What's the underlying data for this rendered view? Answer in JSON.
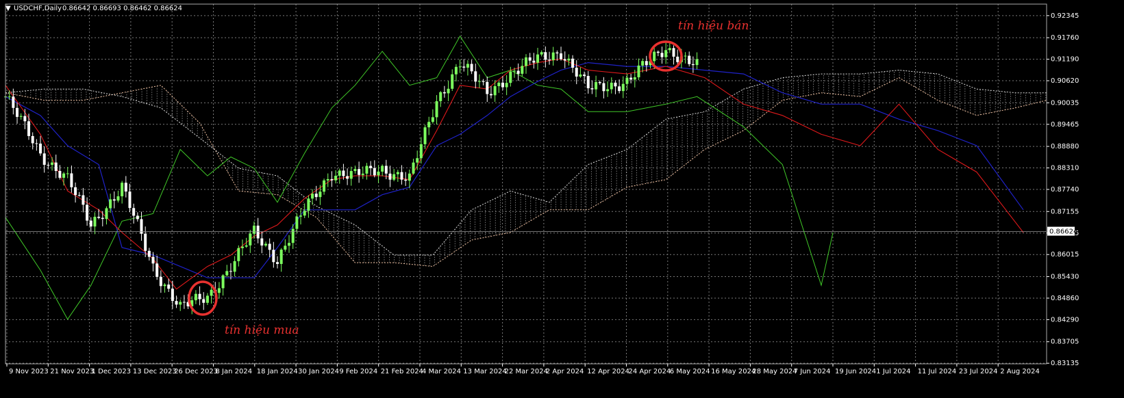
{
  "header": {
    "symbol": "USDCHF,Daily",
    "ohlc": "0.86642 0.86693 0.86462 0.86624"
  },
  "colors": {
    "background": "#000000",
    "grid": "#7a7a7a",
    "bull_candle": "#7cff5e",
    "bear_candle": "#ffffff",
    "tenkan_sen": "#e0191b",
    "kijun_sen": "#1f22c8",
    "chikou_span": "#40c828",
    "cloud": "#e8e8e8",
    "annotation": "#e8312f",
    "text": "#ffffff"
  },
  "annotations": {
    "buy_signal": "tín hiệu mua",
    "sell_signal": "tín hiệu bán"
  },
  "chart_data": {
    "type": "line",
    "ylim": [
      0.8312,
      0.9265
    ],
    "y_ticks": [
      "0.92345",
      "0.91760",
      "0.91190",
      "0.90620",
      "0.90035",
      "0.89465",
      "0.88880",
      "0.88310",
      "0.87740",
      "0.87155",
      "0.86585",
      "0.86015",
      "0.85430",
      "0.84860",
      "0.84290",
      "0.83705",
      "0.83135"
    ],
    "x_ticks": [
      "9 Nov 2023",
      "21 Nov 2023",
      "1 Dec 2023",
      "13 Dec 2023",
      "26 Dec 2023",
      "8 Jan 2024",
      "18 Jan 2024",
      "30 Jan 2024",
      "9 Feb 2024",
      "21 Feb 2024",
      "4 Mar 2024",
      "13 Mar 2024",
      "22 Mar 2024",
      "2 Apr 2024",
      "12 Apr 2024",
      "24 Apr 2024",
      "6 May 2024",
      "16 May 2024",
      "28 May 2024",
      "7 Jun 2024",
      "19 Jun 2024",
      "1 Jul 2024",
      "11 Jul 2024",
      "23 Jul 2024",
      "2 Aug 2024"
    ],
    "last_price": "0.86624",
    "series": [
      {
        "key": "price",
        "x": [
          0,
          9,
          16,
          22,
          30,
          38,
          45,
          52,
          58,
          64,
          70,
          77,
          84,
          90,
          97,
          104,
          111,
          117,
          124,
          130,
          137,
          143,
          150,
          160,
          170,
          178
        ],
        "y": [
          0.902,
          0.887,
          0.88,
          0.868,
          0.878,
          0.857,
          0.846,
          0.849,
          0.857,
          0.866,
          0.859,
          0.872,
          0.882,
          0.881,
          0.883,
          0.88,
          0.901,
          0.911,
          0.903,
          0.908,
          0.912,
          0.914,
          0.904,
          0.906,
          0.915,
          0.91
        ]
      },
      {
        "key": "tenkan",
        "x": [
          0,
          9,
          16,
          24,
          30,
          38,
          44,
          52,
          58,
          64,
          70,
          77,
          84,
          90,
          97,
          104,
          111,
          117,
          124,
          130,
          137,
          143,
          150,
          160,
          170,
          180,
          190,
          200,
          210,
          220,
          230,
          240,
          250,
          262
        ],
        "y": [
          0.905,
          0.892,
          0.877,
          0.872,
          0.866,
          0.859,
          0.851,
          0.857,
          0.86,
          0.865,
          0.868,
          0.875,
          0.88,
          0.881,
          0.881,
          0.88,
          0.893,
          0.905,
          0.904,
          0.909,
          0.911,
          0.912,
          0.909,
          0.908,
          0.91,
          0.907,
          0.9,
          0.897,
          0.892,
          0.889,
          0.9,
          0.888,
          0.882,
          0.866
        ]
      },
      {
        "key": "kijun",
        "x": [
          0,
          9,
          16,
          24,
          30,
          38,
          45,
          52,
          58,
          64,
          70,
          77,
          84,
          90,
          97,
          104,
          111,
          117,
          124,
          130,
          137,
          143,
          150,
          160,
          170,
          180,
          190,
          200,
          210,
          220,
          230,
          240,
          250,
          262
        ],
        "y": [
          0.902,
          0.897,
          0.889,
          0.884,
          0.862,
          0.86,
          0.857,
          0.854,
          0.854,
          0.854,
          0.862,
          0.872,
          0.872,
          0.872,
          0.876,
          0.878,
          0.889,
          0.892,
          0.897,
          0.902,
          0.906,
          0.909,
          0.911,
          0.91,
          0.91,
          0.909,
          0.908,
          0.903,
          0.9,
          0.9,
          0.896,
          0.893,
          0.889,
          0.872
        ]
      },
      {
        "key": "chikou",
        "x": [
          0,
          9,
          16,
          22,
          30,
          38,
          45,
          52,
          58,
          64,
          70,
          77,
          84,
          90,
          97,
          104,
          111,
          117,
          124,
          130,
          137,
          143,
          150,
          160,
          170,
          178,
          190,
          200,
          210,
          213
        ],
        "y": [
          0.87,
          0.856,
          0.843,
          0.852,
          0.869,
          0.871,
          0.888,
          0.881,
          0.886,
          0.883,
          0.874,
          0.887,
          0.899,
          0.905,
          0.914,
          0.905,
          0.907,
          0.918,
          0.907,
          0.909,
          0.905,
          0.904,
          0.898,
          0.898,
          0.9,
          0.902,
          0.894,
          0.884,
          0.852,
          0.866
        ]
      },
      {
        "key": "span_a",
        "x": [
          0,
          10,
          20,
          30,
          40,
          50,
          60,
          70,
          80,
          90,
          100,
          110,
          120,
          130,
          140,
          150,
          160,
          170,
          180,
          190,
          200,
          210,
          220,
          230,
          240,
          250,
          260,
          268
        ],
        "y": [
          0.903,
          0.901,
          0.901,
          0.903,
          0.905,
          0.895,
          0.877,
          0.876,
          0.87,
          0.858,
          0.858,
          0.857,
          0.864,
          0.866,
          0.872,
          0.872,
          0.878,
          0.88,
          0.888,
          0.893,
          0.901,
          0.903,
          0.902,
          0.907,
          0.901,
          0.897,
          0.899,
          0.901
        ]
      },
      {
        "key": "span_b",
        "x": [
          0,
          10,
          20,
          30,
          40,
          50,
          60,
          70,
          80,
          90,
          100,
          110,
          120,
          130,
          140,
          150,
          160,
          170,
          180,
          190,
          200,
          210,
          220,
          230,
          240,
          250,
          260,
          268
        ],
        "y": [
          0.903,
          0.904,
          0.904,
          0.902,
          0.899,
          0.891,
          0.883,
          0.881,
          0.873,
          0.868,
          0.86,
          0.86,
          0.872,
          0.877,
          0.874,
          0.884,
          0.888,
          0.896,
          0.898,
          0.904,
          0.907,
          0.908,
          0.908,
          0.909,
          0.908,
          0.904,
          0.903,
          0.903
        ]
      }
    ]
  }
}
